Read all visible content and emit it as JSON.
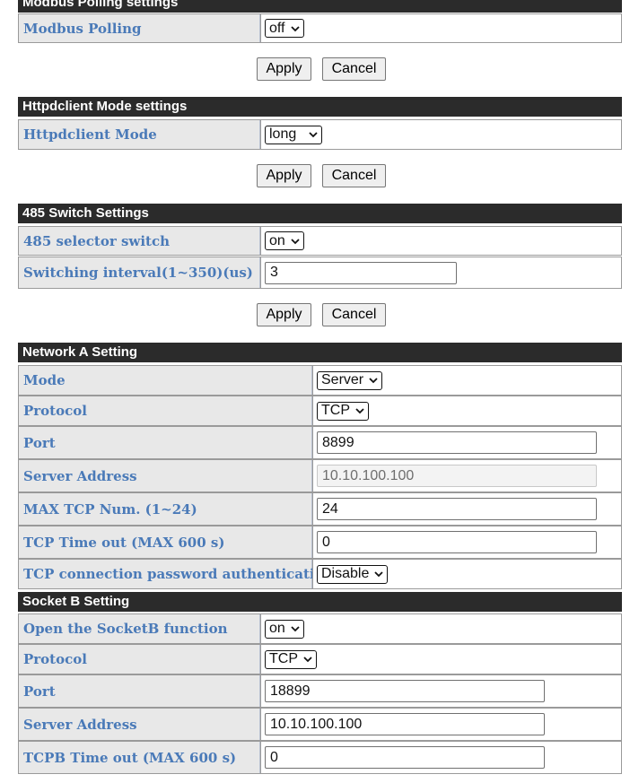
{
  "buttons": {
    "apply": "Apply",
    "cancel": "Cancel"
  },
  "modbus": {
    "title": "Modbus Polling settings",
    "polling_label": "Modbus Polling",
    "polling_value": "off"
  },
  "httpd": {
    "title": "Httpdclient Mode settings",
    "mode_label": "Httpdclient Mode",
    "mode_value": "long"
  },
  "s485": {
    "title": "485 Switch Settings",
    "selector_label": "485 selector switch",
    "selector_value": "on",
    "interval_label": "Switching interval(1~350)(us)",
    "interval_value": "3"
  },
  "networkA": {
    "title": "Network A Setting",
    "mode_label": "Mode",
    "mode_value": "Server",
    "protocol_label": "Protocol",
    "protocol_value": "TCP",
    "port_label": "Port",
    "port_value": "8899",
    "server_label": "Server Address",
    "server_value": "10.10.100.100",
    "maxtcp_label": "MAX TCP Num. (1~24)",
    "maxtcp_value": "24",
    "timeout_label": "TCP Time out (MAX 600 s)",
    "timeout_value": "0",
    "auth_label": "TCP connection password authentication",
    "auth_value": "Disable"
  },
  "socketB": {
    "title": "Socket B Setting",
    "open_label": "Open the SocketB function",
    "open_value": "on",
    "protocol_label": "Protocol",
    "protocol_value": "TCP",
    "port_label": "Port",
    "port_value": "18899",
    "server_label": "Server Address",
    "server_value": "10.10.100.100",
    "timeout_label": "TCPB Time out (MAX 600 s)",
    "timeout_value": "0"
  }
}
